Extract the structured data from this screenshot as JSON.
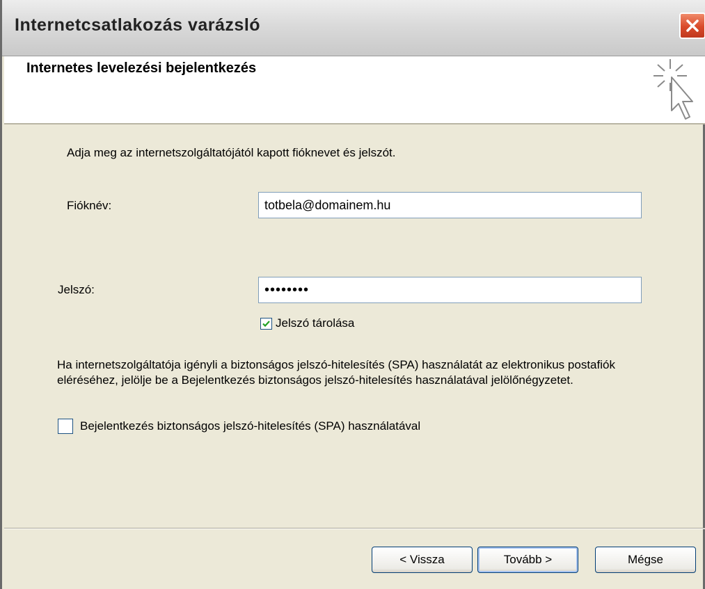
{
  "window": {
    "title": "Internetcsatlakozás varázsló"
  },
  "header": {
    "title": "Internetes levelezési bejelentkezés"
  },
  "form": {
    "intro": "Adja meg az internetszolgáltatójától kapott fióknevet és jelszót.",
    "account_label": "Fióknév:",
    "account_value": "totbela@domainem.hu",
    "password_label": "Jelszó:",
    "password_value": "••••••••",
    "remember_password": {
      "label": "Jelszó tárolása",
      "checked": true
    },
    "spa_paragraph": "Ha internetszolgáltatója igényli a biztonságos jelszó-hitelesítés (SPA) használatát az elektronikus postafiók eléréséhez, jelölje be a Bejelentkezés biztonságos jelszó-hitelesítés használatával jelölőnégyzetet.",
    "spa_checkbox": {
      "label": "Bejelentkezés biztonságos jelszó-hitelesítés (SPA) használatával",
      "checked": false
    }
  },
  "buttons": {
    "back": "< Vissza",
    "next": "Tovább >",
    "cancel": "Mégse"
  },
  "colors": {
    "checkmark": "#21a121",
    "accent_border": "#003c74"
  }
}
